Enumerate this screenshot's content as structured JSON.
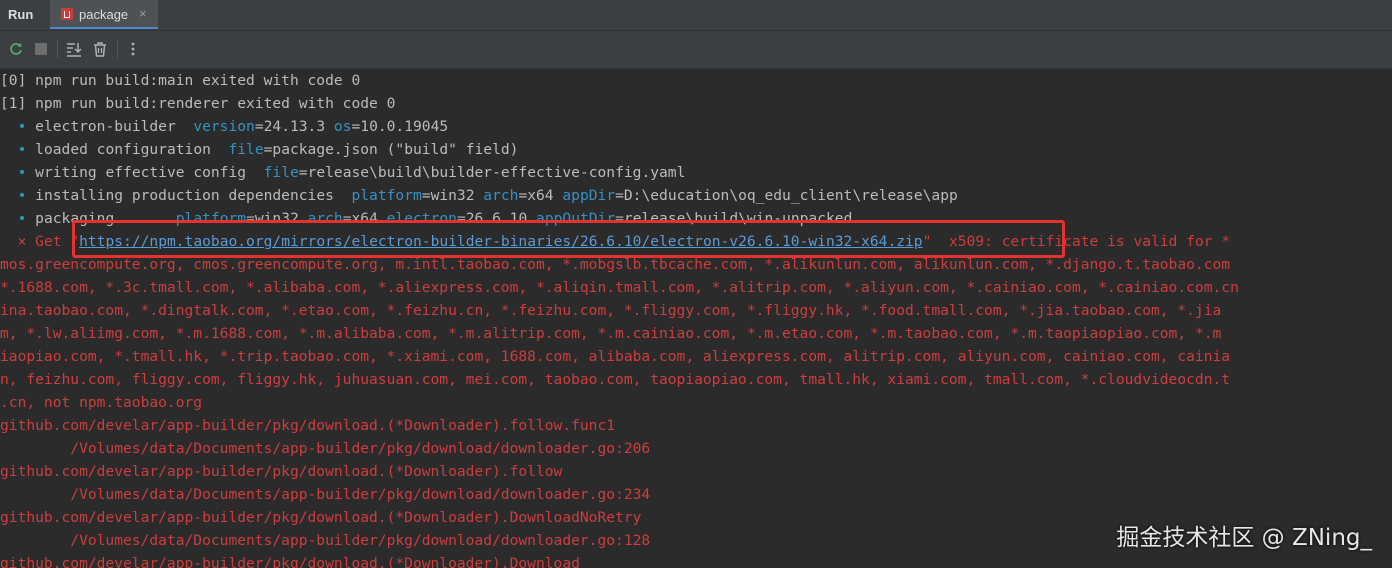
{
  "tabbar": {
    "run_label": "Run",
    "tab_label": "package",
    "tab_close": "×"
  },
  "toolbar": {
    "rerun_icon": "rerun-icon",
    "stop_icon": "stop-icon",
    "scroll_end_icon": "scroll-to-end-icon",
    "clear_icon": "trash-icon",
    "more_icon": "more-vertical-icon"
  },
  "console": {
    "line1": "[0] npm run build:main exited with code 0",
    "line2": "[1] npm run build:renderer exited with code 0",
    "bullet": "•",
    "cross": "×",
    "l3": {
      "a": "electron-builder  ",
      "k1": "version",
      "v1": "=24.13.3 ",
      "k2": "os",
      "v2": "=10.0.19045"
    },
    "l4": {
      "a": "loaded configuration  ",
      "k1": "file",
      "v1": "=package.json (\"build\" field)"
    },
    "l5": {
      "a": "writing effective config  ",
      "k1": "file",
      "v1": "=release\\build\\builder-effective-config.yaml"
    },
    "l6": {
      "a": "installing production dependencies  ",
      "k1": "platform",
      "v1": "=win32 ",
      "k2": "arch",
      "v2": "=x64 ",
      "k3": "appDir",
      "v3": "=D:\\education\\oq_edu_client\\release\\app"
    },
    "l7": {
      "a": "packaging       ",
      "k1": "platform",
      "v1": "=win32 ",
      "k2": "arch",
      "v2": "=x64 ",
      "k3": "electron",
      "v3": "=26.6.10 ",
      "k4": "appOutDir",
      "v4": "=release\\build\\win-unpacked"
    },
    "l8": {
      "get": "Get ",
      "q1": "\"",
      "url": "https://npm.taobao.org/mirrors/electron-builder-binaries/26.6.10/electron-v26.6.10-win32-x64.zip",
      "q2": "\"",
      "rest": "  x509: certificate is valid for *"
    },
    "err_lines": [
      "mos.greencompute.org, cmos.greencompute.org, m.intl.taobao.com, *.mobgslb.tbcache.com, *.alikunlun.com, alikunlun.com, *.django.t.taobao.com",
      "*.1688.com, *.3c.tmall.com, *.alibaba.com, *.aliexpress.com, *.aliqin.tmall.com, *.alitrip.com, *.aliyun.com, *.cainiao.com, *.cainiao.com.cn",
      "ina.taobao.com, *.dingtalk.com, *.etao.com, *.feizhu.cn, *.feizhu.com, *.fliggy.com, *.fliggy.hk, *.food.tmall.com, *.jia.taobao.com, *.jia",
      "m, *.lw.aliimg.com, *.m.1688.com, *.m.alibaba.com, *.m.alitrip.com, *.m.cainiao.com, *.m.etao.com, *.m.taobao.com, *.m.taopiaopiao.com, *.m",
      "iaopiao.com, *.tmall.hk, *.trip.taobao.com, *.xiami.com, 1688.com, alibaba.com, aliexpress.com, alitrip.com, aliyun.com, cainiao.com, cainia",
      "n, feizhu.com, fliggy.com, fliggy.hk, juhuasuan.com, mei.com, taobao.com, taopiaopiao.com, tmall.hk, xiami.com, tmall.com, *.cloudvideocdn.t",
      ".cn, not npm.taobao.org",
      "github.com/develar/app-builder/pkg/download.(*Downloader).follow.func1",
      "        /Volumes/data/Documents/app-builder/pkg/download/downloader.go:206",
      "github.com/develar/app-builder/pkg/download.(*Downloader).follow",
      "        /Volumes/data/Documents/app-builder/pkg/download/downloader.go:234",
      "github.com/develar/app-builder/pkg/download.(*Downloader).DownloadNoRetry",
      "        /Volumes/data/Documents/app-builder/pkg/download/downloader.go:128",
      "github.com/develar/app-builder/pkg/download.(*Downloader).Download"
    ]
  },
  "watermark": "掘金技术社区 @ ZNing_",
  "colors": {
    "background": "#2b2b2b",
    "error": "#cc3e3e",
    "keyword": "#3592c4",
    "highlight": "#e4332f"
  }
}
